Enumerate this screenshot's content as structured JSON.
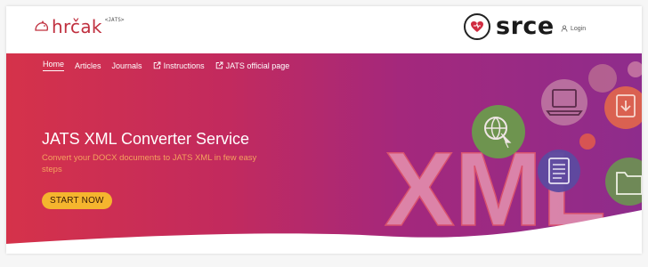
{
  "header": {
    "logo_text": "hrčak",
    "logo_tag": "<JATS>",
    "brand_text": "srce",
    "login_label": "Login"
  },
  "nav": {
    "items": [
      {
        "label": "Home",
        "active": true
      },
      {
        "label": "Articles"
      },
      {
        "label": "Journals"
      },
      {
        "label": "Instructions",
        "icon": "external-link-icon"
      },
      {
        "label": "JATS official page",
        "icon": "external-link-icon"
      }
    ]
  },
  "hero": {
    "title": "JATS XML Converter Service",
    "subtitle": "Convert your DOCX documents to JATS XML in few easy steps",
    "cta_label": "START NOW",
    "watermark_text": "XML"
  },
  "colors": {
    "hero_left": "#d5324a",
    "hero_right": "#8e2c8c",
    "subtitle": "#f4a25e",
    "cta_bg": "#f5b52e",
    "logo": "#c0303f"
  }
}
